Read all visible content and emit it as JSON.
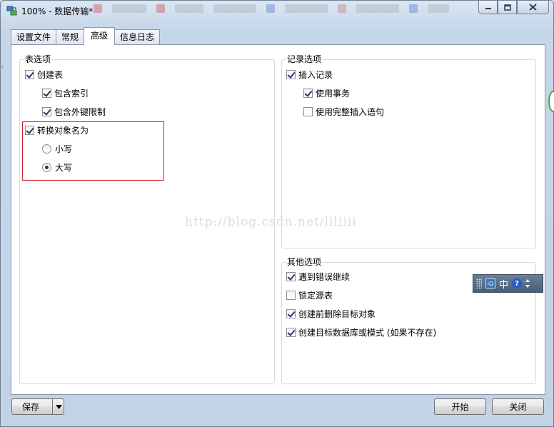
{
  "window": {
    "title": "100% - 数据传输*",
    "buttons": {
      "minimize": "minimize-icon",
      "maximize": "maximize-icon",
      "close": "close-icon"
    }
  },
  "tabs": [
    {
      "label": "设置文件",
      "active": false
    },
    {
      "label": "常规",
      "active": false
    },
    {
      "label": "高级",
      "active": true
    },
    {
      "label": "信息日志",
      "active": false
    }
  ],
  "table_options": {
    "title": "表选项",
    "create_table": {
      "label": "创建表",
      "checked": true
    },
    "include_index": {
      "label": "包含索引",
      "checked": true
    },
    "include_fk": {
      "label": "包含外键限制",
      "checked": true
    },
    "convert_names": {
      "label": "转换对象名为",
      "checked": true
    },
    "lowercase": {
      "label": "小写",
      "selected": false
    },
    "uppercase": {
      "label": "大写",
      "selected": true
    }
  },
  "record_options": {
    "title": "记录选项",
    "insert_records": {
      "label": "插入记录",
      "checked": true
    },
    "use_transaction": {
      "label": "使用事务",
      "checked": true
    },
    "use_complete_insert": {
      "label": "使用完整插入语句",
      "checked": false
    }
  },
  "other_options": {
    "title": "其他选项",
    "continue_on_error": {
      "label": "遇到错误继续",
      "checked": true
    },
    "lock_source": {
      "label": "锁定源表",
      "checked": false
    },
    "drop_before_create": {
      "label": "创建前删除目标对象",
      "checked": true
    },
    "create_target_db": {
      "label": "创建目标数据库或模式 (如果不存在)",
      "checked": true
    }
  },
  "watermark": "http://blog.csdn.net/liliiii",
  "footer": {
    "save_label": "保存",
    "start_label": "开始",
    "close_label": "关闭"
  },
  "ime": {
    "mode": "中",
    "help": "?"
  },
  "colors": {
    "highlight": "#d4222a",
    "frame": "#c6d6e9"
  }
}
